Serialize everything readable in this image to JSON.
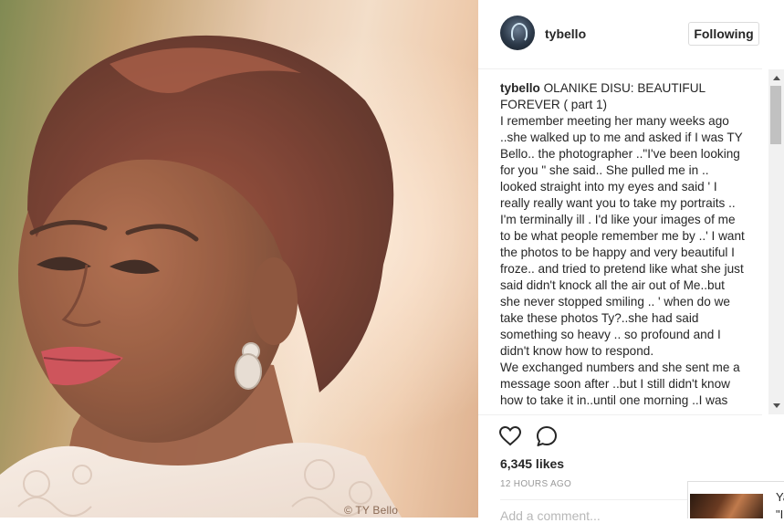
{
  "post": {
    "photo_watermark": "© TY Bello",
    "username": "tybello",
    "follow_button": "Following",
    "caption_author": "tybello",
    "caption_lines": [
      "OLANIKE DISU: BEAUTIFUL FOREVER ( part 1)",
      "I remember meeting her many weeks ago ..she walked up to me and asked if I was TY Bello.. the photographer ..\"I've been looking for you \" she said.. She pulled me in .. looked straight into my eyes and said ' I really really want you to take my portraits .. I'm terminally ill . I'd like your images of me to be what people remember me by ..' I want the photos to be happy and very beautiful I froze.. and tried to pretend like what she just said didn't knock all the air out of Me..but she never stopped smiling .. ' when do we take these photos Ty?..she had said something so heavy .. so profound and I didn't know how to respond.",
      "We exchanged numbers and she sent me a message soon after ..but I still didn't know how to take it in..until one morning ..I was"
    ],
    "likes": "6,345 likes",
    "timestamp": "12 HOURS AGO",
    "add_comment_placeholder": "Add a comment..."
  },
  "popup": {
    "text_line1": "Ya",
    "text_line2": "\"I"
  },
  "icons": {
    "like": "heart-icon",
    "comment": "comment-icon",
    "avatar": "avatar"
  },
  "colors": {
    "text": "#262626",
    "muted": "#999999",
    "border": "#dbdbdb"
  }
}
